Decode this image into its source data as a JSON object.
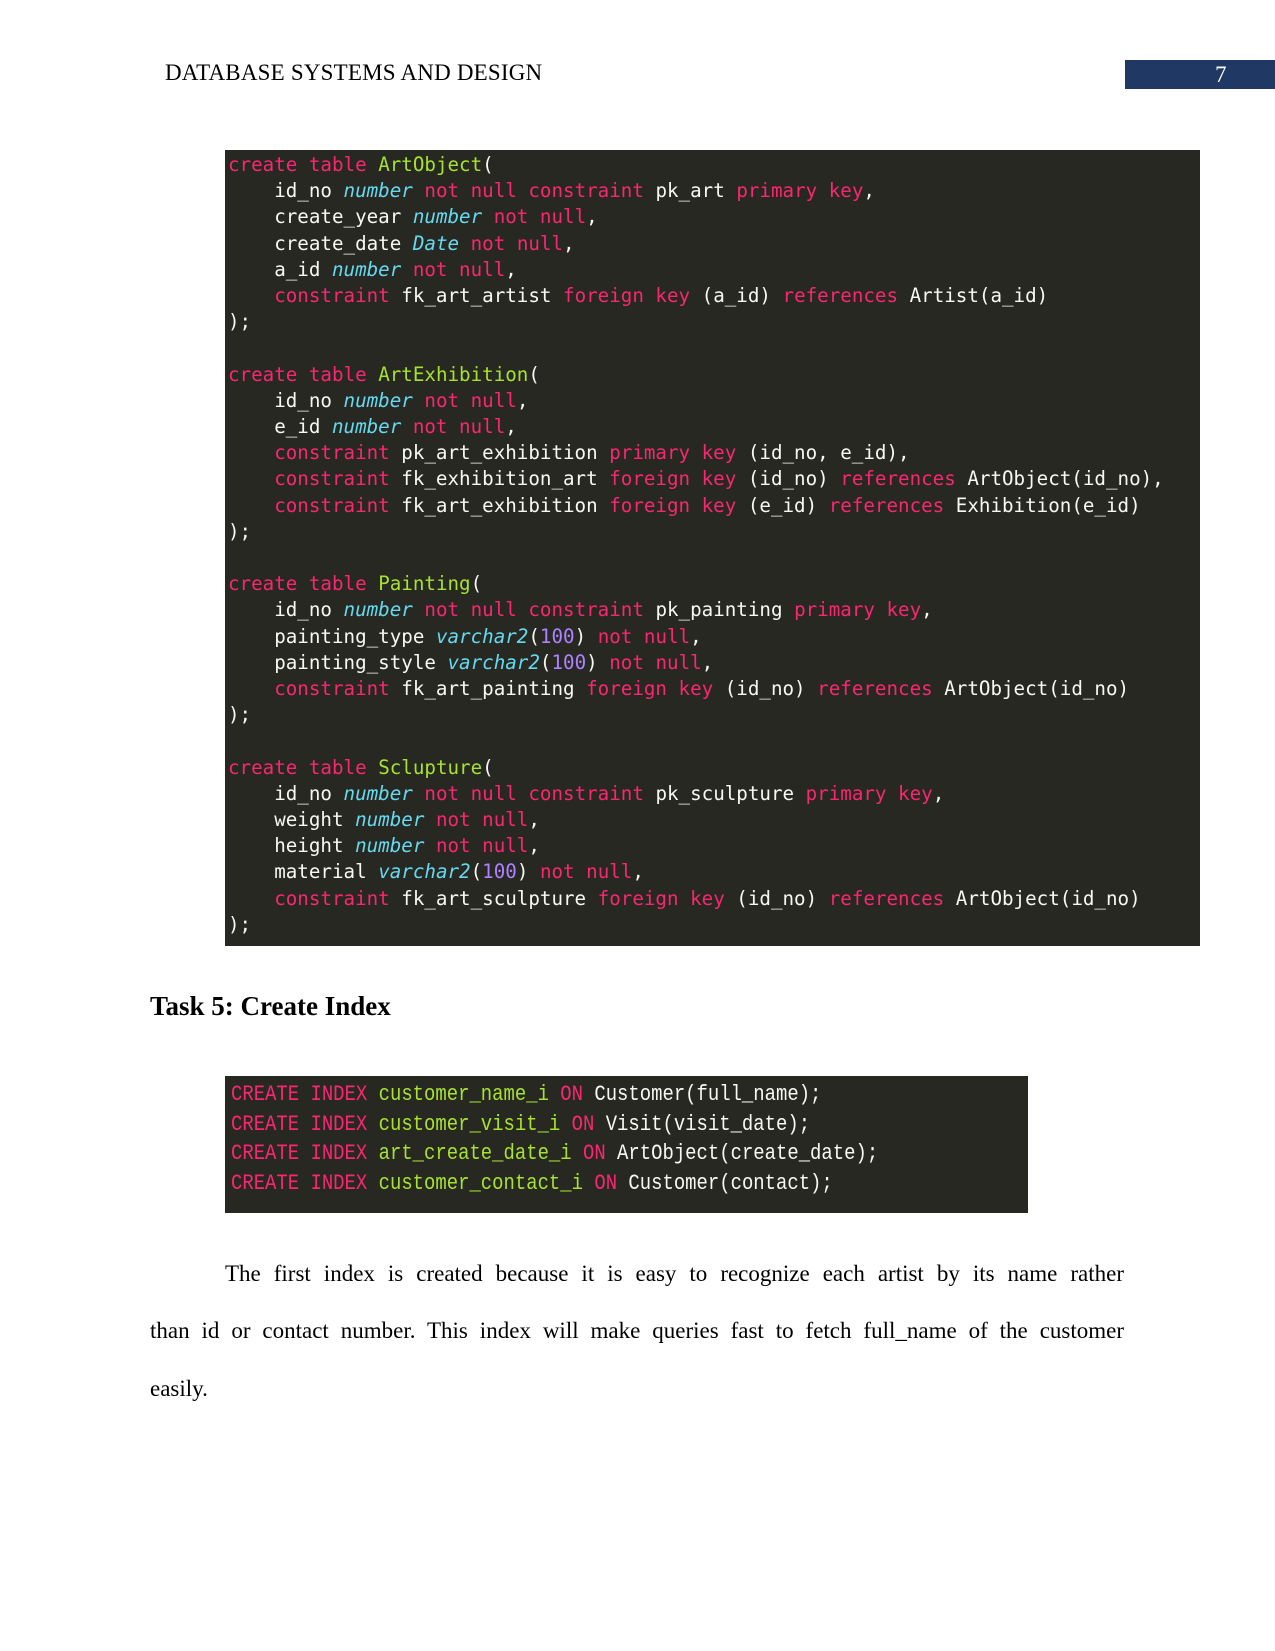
{
  "header": {
    "running_title": "DATABASE SYSTEMS AND DESIGN",
    "page_number": "7",
    "page_number_box_color": "#1f3864"
  },
  "code_colors": {
    "background": "#272822",
    "keyword": "#f92672",
    "type": "#66d9ef",
    "name": "#a6e22e",
    "number": "#ae81ff",
    "plain": "#f8f8f2"
  },
  "create_tables_code": {
    "lines": [
      [
        [
          "kw",
          "create table "
        ],
        [
          "nm",
          "ArtObject"
        ],
        [
          "pl",
          "("
        ]
      ],
      [
        [
          "pl",
          "    id_no "
        ],
        [
          "ty",
          "number"
        ],
        [
          "kw",
          " not null constraint "
        ],
        [
          "pl",
          "pk_art "
        ],
        [
          "kw",
          "primary key"
        ],
        [
          "pl",
          ","
        ]
      ],
      [
        [
          "pl",
          "    create_year "
        ],
        [
          "ty",
          "number"
        ],
        [
          "kw",
          " not null"
        ],
        [
          "pl",
          ","
        ]
      ],
      [
        [
          "pl",
          "    create_date "
        ],
        [
          "ty",
          "Date"
        ],
        [
          "kw",
          " not null"
        ],
        [
          "pl",
          ","
        ]
      ],
      [
        [
          "pl",
          "    a_id "
        ],
        [
          "ty",
          "number"
        ],
        [
          "kw",
          " not null"
        ],
        [
          "pl",
          ","
        ]
      ],
      [
        [
          "kw",
          "    constraint "
        ],
        [
          "pl",
          "fk_art_artist "
        ],
        [
          "kw",
          "foreign key "
        ],
        [
          "pl",
          "(a_id) "
        ],
        [
          "kw",
          "references "
        ],
        [
          "pl",
          "Artist(a_id)"
        ]
      ],
      [
        [
          "pl",
          ");"
        ]
      ],
      [
        [
          "pl",
          ""
        ]
      ],
      [
        [
          "kw",
          "create table "
        ],
        [
          "nm",
          "ArtExhibition"
        ],
        [
          "pl",
          "("
        ]
      ],
      [
        [
          "pl",
          "    id_no "
        ],
        [
          "ty",
          "number"
        ],
        [
          "kw",
          " not null"
        ],
        [
          "pl",
          ","
        ]
      ],
      [
        [
          "pl",
          "    e_id "
        ],
        [
          "ty",
          "number"
        ],
        [
          "kw",
          " not null"
        ],
        [
          "pl",
          ","
        ]
      ],
      [
        [
          "kw",
          "    constraint "
        ],
        [
          "pl",
          "pk_art_exhibition "
        ],
        [
          "kw",
          "primary key "
        ],
        [
          "pl",
          "(id_no, e_id),"
        ]
      ],
      [
        [
          "kw",
          "    constraint "
        ],
        [
          "pl",
          "fk_exhibition_art "
        ],
        [
          "kw",
          "foreign key "
        ],
        [
          "pl",
          "(id_no) "
        ],
        [
          "kw",
          "references "
        ],
        [
          "pl",
          "ArtObject(id_no),"
        ]
      ],
      [
        [
          "kw",
          "    constraint "
        ],
        [
          "pl",
          "fk_art_exhibition "
        ],
        [
          "kw",
          "foreign key "
        ],
        [
          "pl",
          "(e_id) "
        ],
        [
          "kw",
          "references "
        ],
        [
          "pl",
          "Exhibition(e_id)"
        ]
      ],
      [
        [
          "pl",
          ");"
        ]
      ],
      [
        [
          "pl",
          ""
        ]
      ],
      [
        [
          "kw",
          "create table "
        ],
        [
          "nm",
          "Painting"
        ],
        [
          "pl",
          "("
        ]
      ],
      [
        [
          "pl",
          "    id_no "
        ],
        [
          "ty",
          "number"
        ],
        [
          "kw",
          " not null constraint "
        ],
        [
          "pl",
          "pk_painting "
        ],
        [
          "kw",
          "primary key"
        ],
        [
          "pl",
          ","
        ]
      ],
      [
        [
          "pl",
          "    painting_type "
        ],
        [
          "ty",
          "varchar2"
        ],
        [
          "pl",
          "("
        ],
        [
          "num",
          "100"
        ],
        [
          "pl",
          ")"
        ],
        [
          "kw",
          " not null"
        ],
        [
          "pl",
          ","
        ]
      ],
      [
        [
          "pl",
          "    painting_style "
        ],
        [
          "ty",
          "varchar2"
        ],
        [
          "pl",
          "("
        ],
        [
          "num",
          "100"
        ],
        [
          "pl",
          ")"
        ],
        [
          "kw",
          " not null"
        ],
        [
          "pl",
          ","
        ]
      ],
      [
        [
          "kw",
          "    constraint "
        ],
        [
          "pl",
          "fk_art_painting "
        ],
        [
          "kw",
          "foreign key "
        ],
        [
          "pl",
          "(id_no) "
        ],
        [
          "kw",
          "references "
        ],
        [
          "pl",
          "ArtObject(id_no)"
        ]
      ],
      [
        [
          "pl",
          ");"
        ]
      ],
      [
        [
          "pl",
          ""
        ]
      ],
      [
        [
          "kw",
          "create table "
        ],
        [
          "nm",
          "Sclupture"
        ],
        [
          "pl",
          "("
        ]
      ],
      [
        [
          "pl",
          "    id_no "
        ],
        [
          "ty",
          "number"
        ],
        [
          "kw",
          " not null constraint "
        ],
        [
          "pl",
          "pk_sculpture "
        ],
        [
          "kw",
          "primary key"
        ],
        [
          "pl",
          ","
        ]
      ],
      [
        [
          "pl",
          "    weight "
        ],
        [
          "ty",
          "number"
        ],
        [
          "kw",
          " not null"
        ],
        [
          "pl",
          ","
        ]
      ],
      [
        [
          "pl",
          "    height "
        ],
        [
          "ty",
          "number"
        ],
        [
          "kw",
          " not null"
        ],
        [
          "pl",
          ","
        ]
      ],
      [
        [
          "pl",
          "    material "
        ],
        [
          "ty",
          "varchar2"
        ],
        [
          "pl",
          "("
        ],
        [
          "num",
          "100"
        ],
        [
          "pl",
          ")"
        ],
        [
          "kw",
          " not null"
        ],
        [
          "pl",
          ","
        ]
      ],
      [
        [
          "kw",
          "    constraint "
        ],
        [
          "pl",
          "fk_art_sculpture "
        ],
        [
          "kw",
          "foreign key "
        ],
        [
          "pl",
          "(id_no) "
        ],
        [
          "kw",
          "references "
        ],
        [
          "pl",
          "ArtObject(id_no)"
        ]
      ],
      [
        [
          "pl",
          ");"
        ]
      ]
    ]
  },
  "task_heading": "Task 5: Create Index",
  "index_code": {
    "lines": [
      [
        [
          "kw",
          "CREATE INDEX "
        ],
        [
          "nm",
          "customer_name_i "
        ],
        [
          "kw",
          "ON "
        ],
        [
          "pl",
          "Customer(full_name);"
        ]
      ],
      [
        [
          "kw",
          "CREATE INDEX "
        ],
        [
          "nm",
          "customer_visit_i "
        ],
        [
          "kw",
          "ON "
        ],
        [
          "pl",
          "Visit(visit_date);"
        ]
      ],
      [
        [
          "kw",
          "CREATE INDEX "
        ],
        [
          "nm",
          "art_create_date_i "
        ],
        [
          "kw",
          "ON "
        ],
        [
          "pl",
          "ArtObject(create_date);"
        ]
      ],
      [
        [
          "kw",
          "CREATE INDEX "
        ],
        [
          "nm",
          "customer_contact_i "
        ],
        [
          "kw",
          "ON "
        ],
        [
          "pl",
          "Customer(contact);"
        ]
      ]
    ]
  },
  "body": {
    "line1": "The first index is created because it is easy to recognize each artist by its name rather",
    "line2": "than id or contact number. This index will make queries fast to fetch full_name of the customer",
    "line3": "easily."
  }
}
